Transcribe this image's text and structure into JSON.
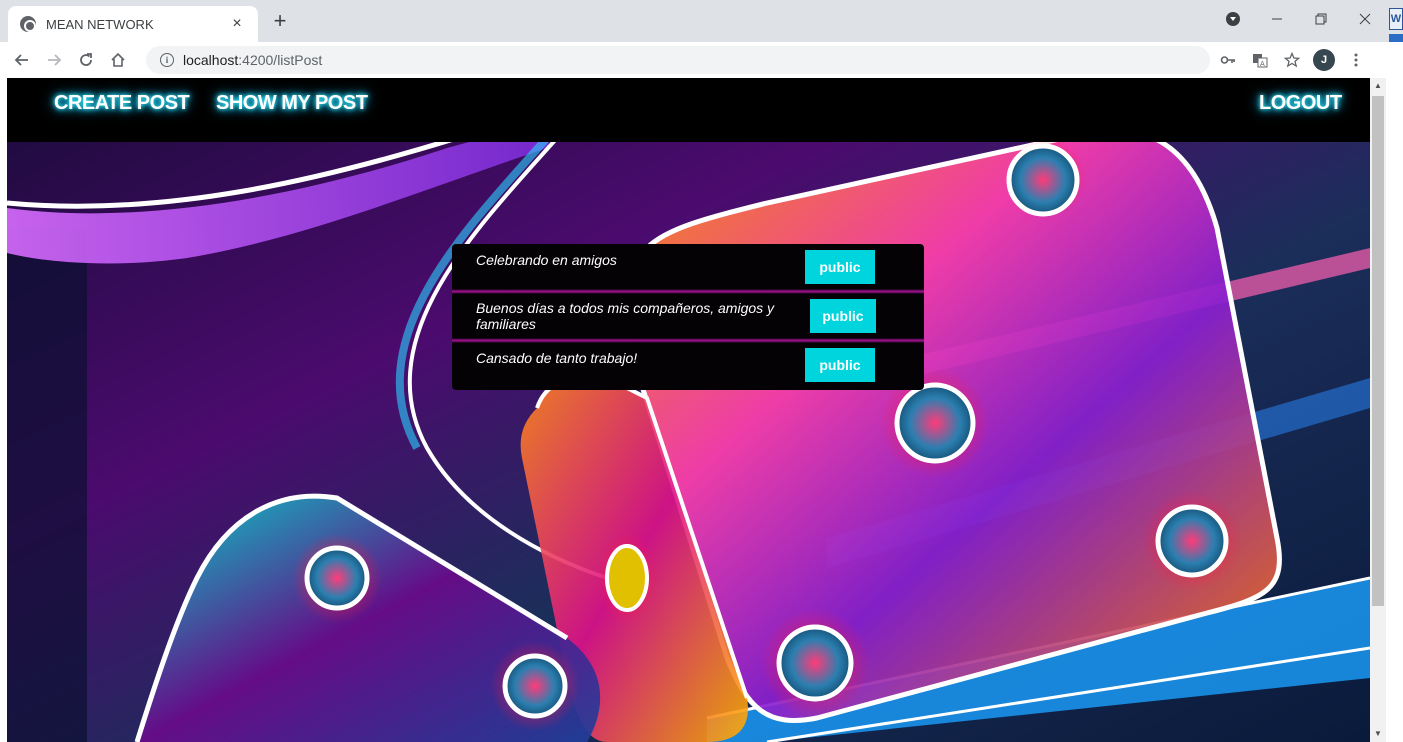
{
  "browser": {
    "tab_title": "MEAN NETWORK",
    "tab_close": "×",
    "new_tab": "+",
    "url_host": "localhost",
    "url_path": ":4200/listPost",
    "avatar_letter": "J",
    "icons": [
      "back-arrow-icon",
      "forward-arrow-icon",
      "reload-icon",
      "home-icon",
      "info-icon",
      "key-icon",
      "translate-icon",
      "star-icon",
      "menu-icon"
    ]
  },
  "nav": {
    "create_post": "CREATE POST",
    "show_my_post": "SHOW MY POST",
    "logout": "LOGOUT",
    "glow_color": "#21d9ff"
  },
  "posts": [
    {
      "text": "Celebrando en amigos",
      "button": "public"
    },
    {
      "text": "Buenos días a todos mis compañeros, amigos y familiares",
      "button": "public"
    },
    {
      "text": "Cansado de tanto trabajo!",
      "button": "public"
    }
  ],
  "colors": {
    "button": "#00d4dc",
    "separator": "#be14aa",
    "panel": "#050206"
  }
}
